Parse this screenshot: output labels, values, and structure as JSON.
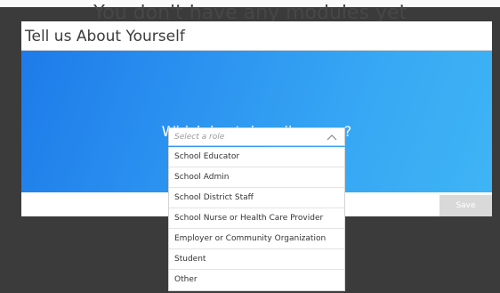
{
  "backdrop": {
    "title": "You don't have any modules yet"
  },
  "modal": {
    "title": "Tell us About Yourself",
    "question": "Which best describes you?",
    "save_label": "Save"
  },
  "role_select": {
    "placeholder": "Select a role",
    "options": [
      "School Educator",
      "School Admin",
      "School District Staff",
      "School Nurse or Health Care Provider",
      "Employer or Community Organization",
      "Student",
      "Other"
    ]
  },
  "colors": {
    "hero_start": "#1e7bea",
    "hero_end": "#3fb4f5",
    "overlay": "#3a3a3a",
    "save_disabled": "#d9d9d9"
  },
  "icons": {
    "select_toggle": "chevron-up-icon"
  }
}
